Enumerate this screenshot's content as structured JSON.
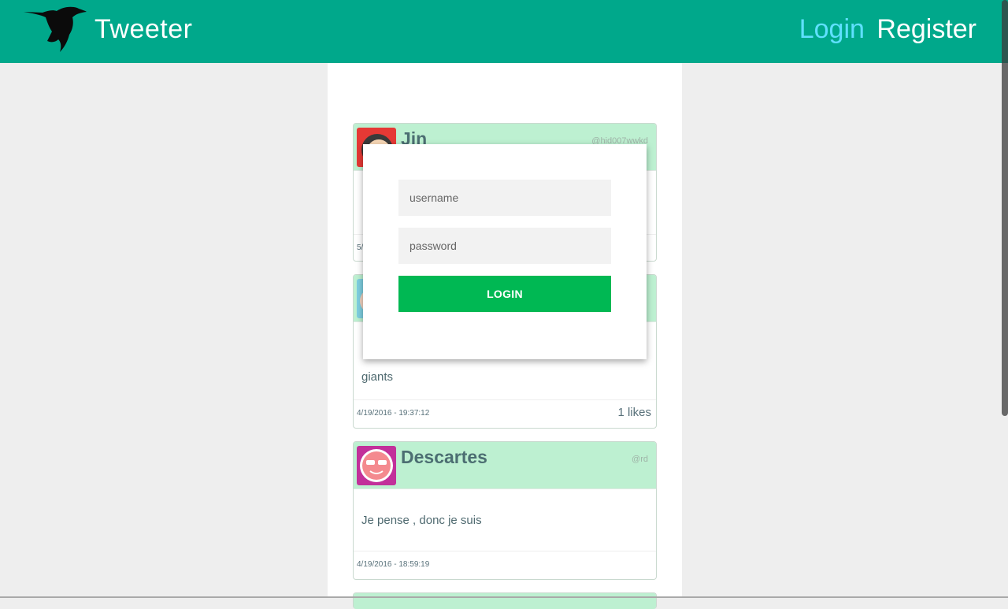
{
  "header": {
    "brand": "Tweeter",
    "login_link": "Login",
    "register_link": "Register"
  },
  "tweets": [
    {
      "name": "Jin",
      "handle": "@hid007wwkd",
      "body": "",
      "date": "5/",
      "likes": ""
    },
    {
      "name": "",
      "handle": "",
      "body": "giants",
      "date": "4/19/2016 - 19:37:12",
      "likes": "1 likes"
    },
    {
      "name": "Descartes",
      "handle": "@rd",
      "body": "Je pense , donc je suis",
      "date": "4/19/2016 - 18:59:19",
      "likes": ""
    }
  ],
  "login_modal": {
    "username_placeholder": "username",
    "password_placeholder": "password",
    "submit_label": "LOGIN"
  },
  "colors": {
    "header_bg": "#00a88b",
    "card_header_bg": "#bdf0d1",
    "login_button_bg": "#00b853",
    "login_link": "#5fe0ff"
  }
}
